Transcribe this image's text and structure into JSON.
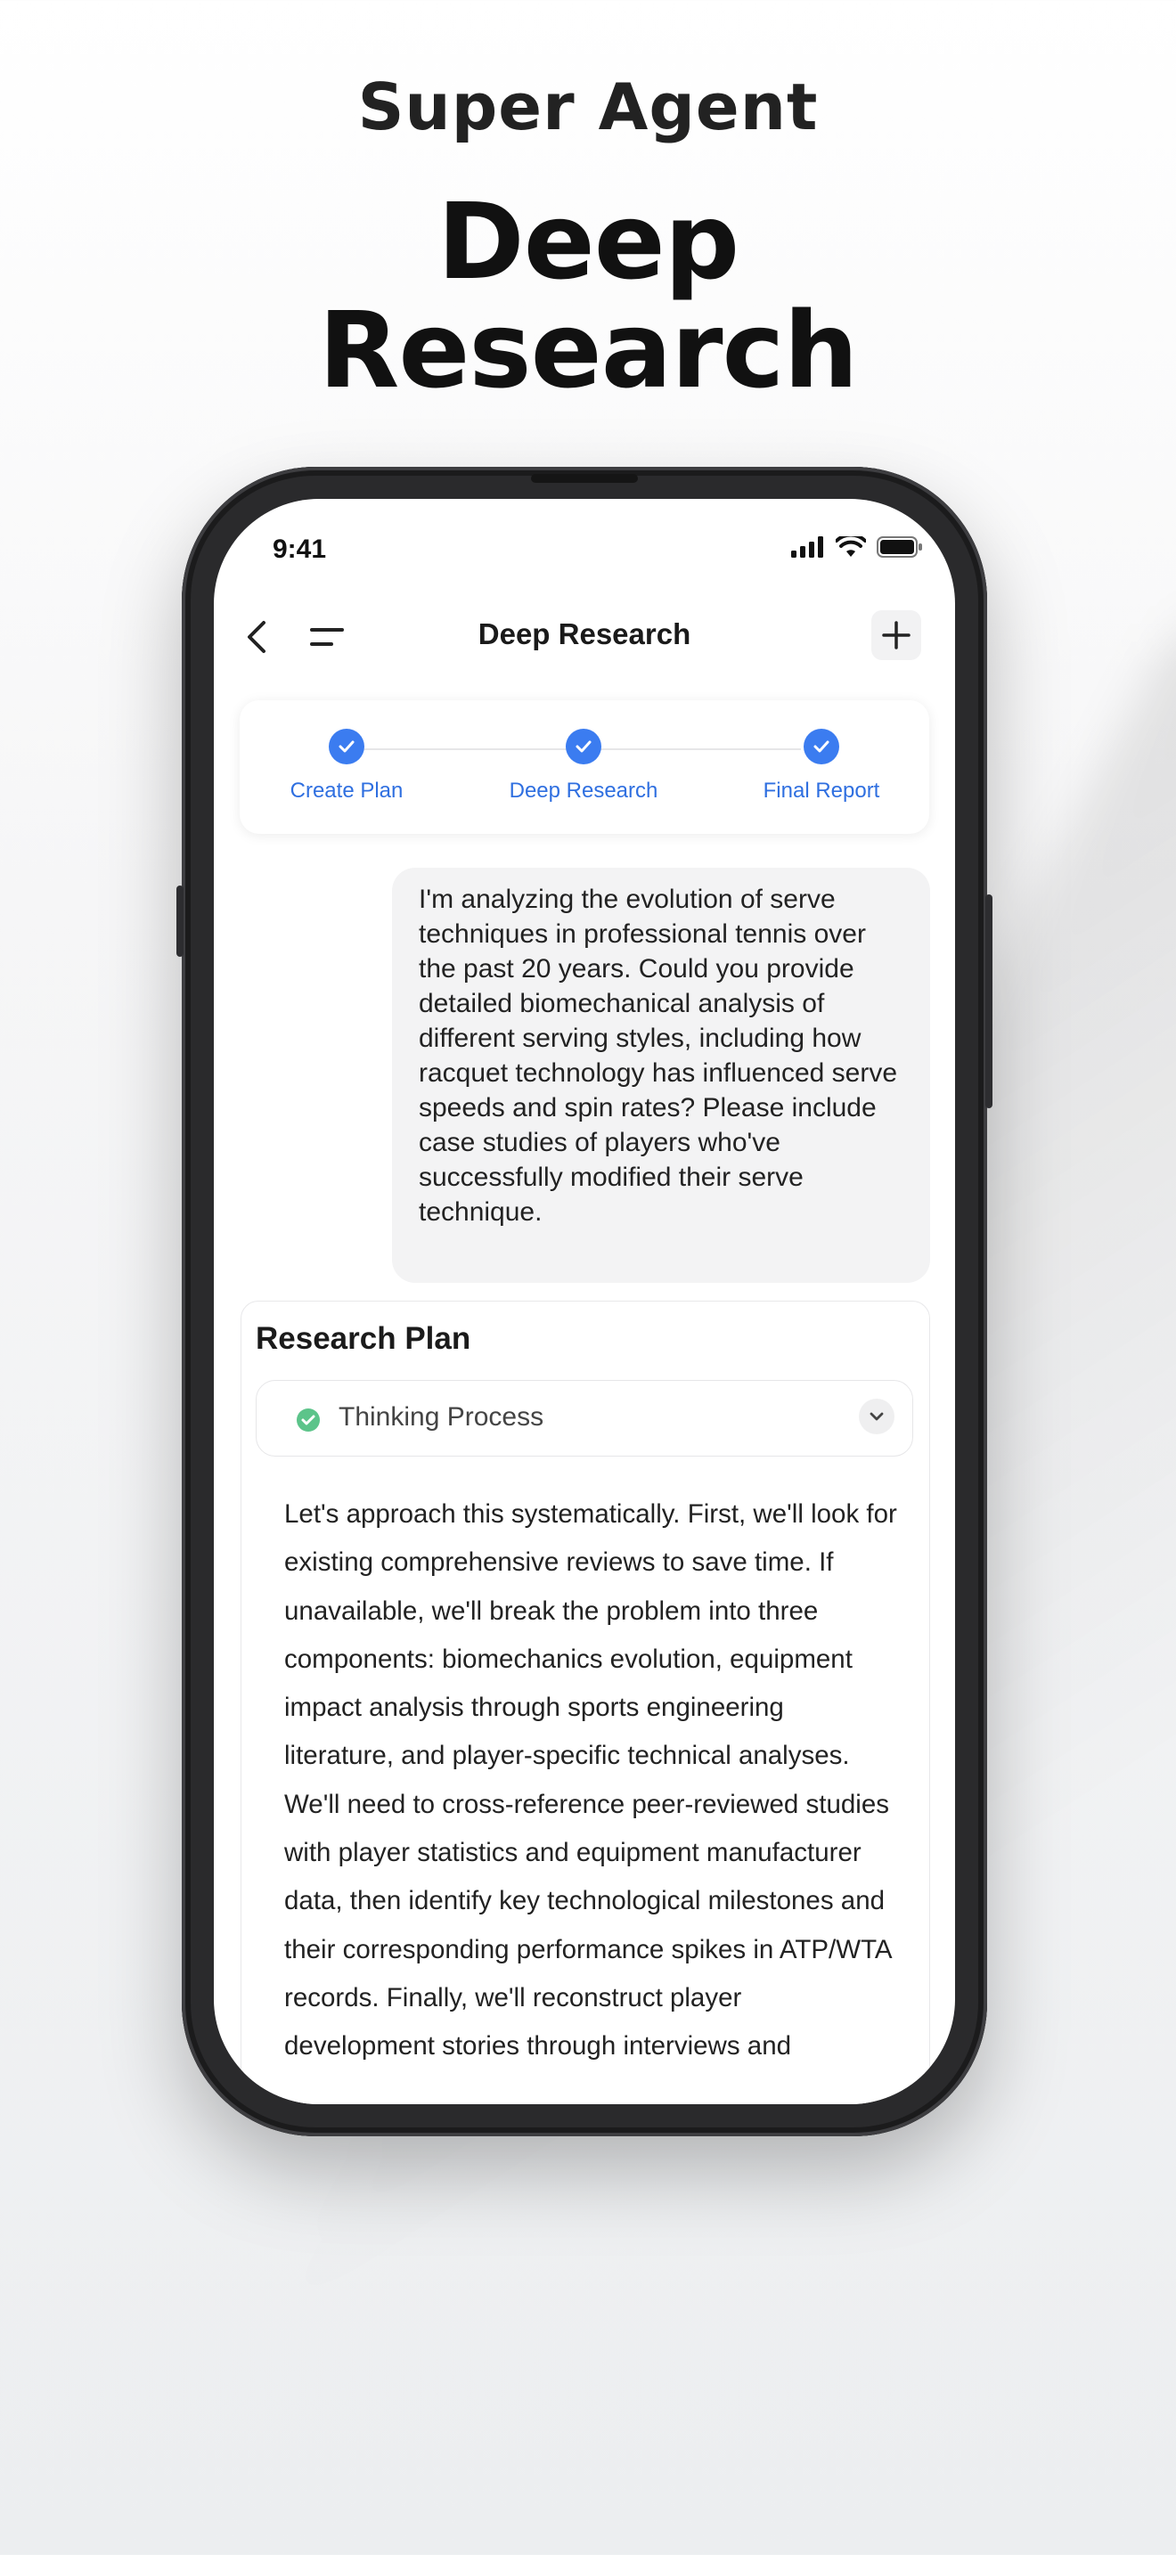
{
  "promo": {
    "kicker": "Super Agent",
    "title_line1": "Deep",
    "title_line2": "Research"
  },
  "status_bar": {
    "time": "9:41",
    "icons": [
      "signal-icon",
      "wifi-icon",
      "battery-icon"
    ]
  },
  "navbar": {
    "title": "Deep Research",
    "icons": [
      "back-chevron-icon",
      "menu-icon",
      "plus-icon"
    ]
  },
  "stepper": {
    "steps": [
      {
        "label": "Create Plan",
        "done": true
      },
      {
        "label": "Deep Research",
        "done": true
      },
      {
        "label": "Final Report",
        "done": true
      }
    ],
    "accent": "#3b7cf0"
  },
  "user_message": "I'm analyzing the evolution of serve techniques in professional tennis over the past 20 years. Could you provide detailed biomechanical analysis of different serving styles, including how racquet technology has influenced serve speeds and spin rates? Please include case studies of players who've successfully modified their serve technique.",
  "research_plan": {
    "title": "Research Plan",
    "thinking_label": "Thinking Process",
    "thinking_status_color": "#5cc48a",
    "body": "Let's approach this systematically. First, we'll look for existing comprehensive reviews to save time. If unavailable, we'll break the problem into three components: biomechanics evolution, equipment impact analysis through sports engineering literature, and player-specific technical analyses. We'll need to cross-reference peer-reviewed studies with player statistics and equipment manufacturer data, then identify key technological milestones and their corresponding performance spikes in ATP/WTA records. Finally, we'll reconstruct player development stories through interviews and"
  }
}
